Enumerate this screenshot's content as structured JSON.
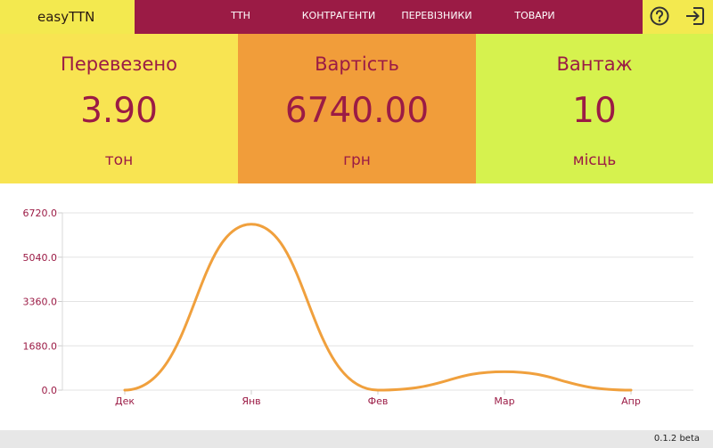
{
  "app": {
    "title": "easyTTN",
    "version": "0.1.2 beta"
  },
  "nav": {
    "items": [
      {
        "label": "ТТН"
      },
      {
        "label": "КОНТРАГЕНТИ"
      },
      {
        "label": "ПЕРЕВІЗНИКИ"
      },
      {
        "label": "ТОВАРИ"
      }
    ]
  },
  "icons": {
    "help": "help-circle-icon",
    "logout": "exit-icon"
  },
  "stats": [
    {
      "title": "Перевезено",
      "value": "3.90",
      "unit": "тон"
    },
    {
      "title": "Вартість",
      "value": "6740.00",
      "unit": "грн"
    },
    {
      "title": "Вантаж",
      "value": "10",
      "unit": "місць"
    }
  ],
  "colors": {
    "primary": "#9b1b45",
    "yellow": "#f8e452",
    "orange": "#f19d3a",
    "lime": "#d6f24e",
    "line": "#f0a03d"
  },
  "chart_data": {
    "type": "line",
    "categories": [
      "Дек",
      "Янв",
      "Фев",
      "Мар",
      "Апр"
    ],
    "series": [
      {
        "values": [
          0,
          6288,
          0,
          698,
          0
        ]
      }
    ],
    "ylim": [
      0,
      6720
    ],
    "yticks": [
      "0.0",
      "1680.0",
      "3360.0",
      "5040.0",
      "6720.0"
    ],
    "grid": true,
    "smooth": true
  }
}
